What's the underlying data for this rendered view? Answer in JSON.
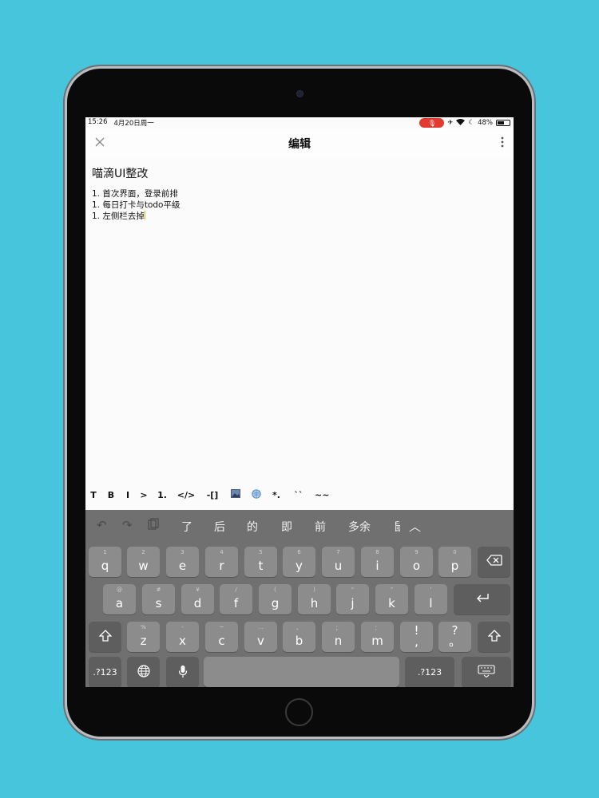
{
  "status_bar": {
    "time": "15:26",
    "date": "4月20日周一",
    "battery": "48%"
  },
  "nav": {
    "title": "编辑"
  },
  "document": {
    "title": "喵滴UI整改",
    "items": [
      "1. 首次界面，登录前排",
      "1. 每日打卡与todo平级",
      "1. 左侧栏去掉"
    ]
  },
  "md_toolbar": [
    "T",
    "B",
    "I",
    ">",
    "1.",
    "</>",
    "-[]",
    "image-icon",
    "globe-icon",
    "*.",
    "``",
    "~~"
  ],
  "keyboard": {
    "suggestions": [
      "了",
      "后",
      "的",
      "即",
      "前",
      "多余",
      "鼠"
    ],
    "row1": [
      {
        "hint": "1",
        "key": "q"
      },
      {
        "hint": "2",
        "key": "w"
      },
      {
        "hint": "3",
        "key": "e"
      },
      {
        "hint": "4",
        "key": "r"
      },
      {
        "hint": "5",
        "key": "t"
      },
      {
        "hint": "6",
        "key": "y"
      },
      {
        "hint": "7",
        "key": "u"
      },
      {
        "hint": "8",
        "key": "i"
      },
      {
        "hint": "9",
        "key": "o"
      },
      {
        "hint": "0",
        "key": "p"
      }
    ],
    "row2": [
      {
        "hint": "@",
        "key": "a"
      },
      {
        "hint": "#",
        "key": "s"
      },
      {
        "hint": "¥",
        "key": "d"
      },
      {
        "hint": "/",
        "key": "f"
      },
      {
        "hint": "(",
        "key": "g"
      },
      {
        "hint": ")",
        "key": "h"
      },
      {
        "hint": "“",
        "key": "j"
      },
      {
        "hint": "”",
        "key": "k"
      },
      {
        "hint": "'",
        "key": "l"
      }
    ],
    "row3": [
      {
        "hint": "%",
        "key": "z"
      },
      {
        "hint": "-",
        "key": "x"
      },
      {
        "hint": "~",
        "key": "c"
      },
      {
        "hint": "…",
        "key": "v"
      },
      {
        "hint": "、",
        "key": "b"
      },
      {
        "hint": "；",
        "key": "n"
      },
      {
        "hint": "：",
        "key": "m"
      },
      {
        "hint": "",
        "key": "!\n,"
      },
      {
        "hint": "",
        "key": "?\n。"
      }
    ],
    "mode_key": ".?123",
    "mode_key_right": ".?123"
  }
}
